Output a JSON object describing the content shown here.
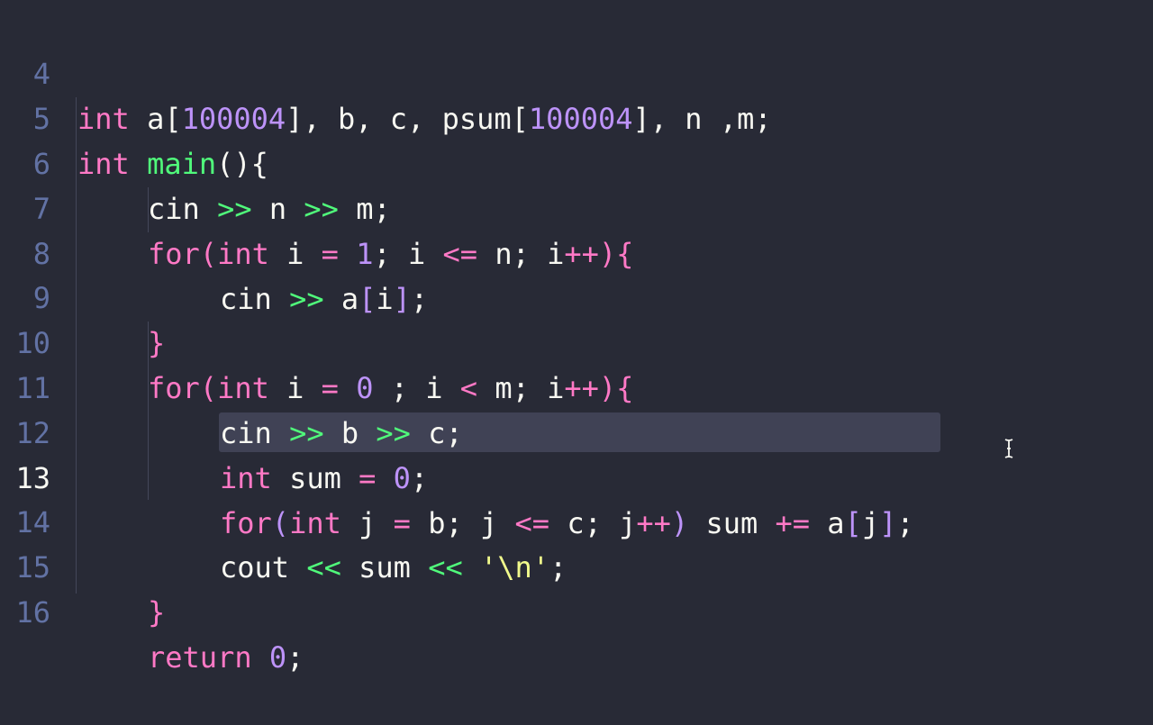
{
  "editor": {
    "lines": [
      {
        "num": "4"
      },
      {
        "num": "5"
      },
      {
        "num": "6"
      },
      {
        "num": "7"
      },
      {
        "num": "8"
      },
      {
        "num": "9"
      },
      {
        "num": "10"
      },
      {
        "num": "11"
      },
      {
        "num": "12"
      },
      {
        "num": "13"
      },
      {
        "num": "14"
      },
      {
        "num": "15"
      },
      {
        "num": "16"
      }
    ],
    "current_line": "13",
    "theme_colors": {
      "background": "#282a36",
      "keyword": "#ff79c6",
      "function": "#50fa7b",
      "number": "#bd93f9",
      "string": "#f1fa8c",
      "line_highlight": "#44475a"
    }
  },
  "code": {
    "l4": {
      "t1": "int",
      "t2": " a[",
      "n1": "100004",
      "t3": "], b, c, psum[",
      "n2": "100004",
      "t4": "], n ,m;"
    },
    "l5": {
      "t1": "int",
      "t2": " ",
      "fn": "main",
      "t3": "(){"
    },
    "l6": {
      "t1": "cin ",
      "op1": ">>",
      "t2": " n ",
      "op2": ">>",
      "t3": " m;"
    },
    "l7": {
      "kw": "for",
      "p1": "(",
      "ty": "int",
      "t1": " i ",
      "op1": "=",
      "t2": " ",
      "n1": "1",
      "t3": "; i ",
      "op2": "<=",
      "t4": " n; i",
      "op3": "++",
      "p2": ")",
      "p3": "{"
    },
    "l8": {
      "t1": "cin ",
      "op1": ">>",
      "t2": " a",
      "b1": "[",
      "t3": "i",
      "b2": "]",
      "t4": ";"
    },
    "l9": {
      "p1": "}"
    },
    "l10": {
      "kw": "for",
      "p1": "(",
      "ty": "int",
      "t1": " i ",
      "op1": "=",
      "t2": " ",
      "n1": "0",
      "t3": " ; i ",
      "op2": "<",
      "t4": " m; i",
      "op3": "++",
      "p2": ")",
      "p3": "{"
    },
    "l11": {
      "t1": "cin ",
      "op1": ">>",
      "t2": " b ",
      "op2": ">>",
      "t3": " c;"
    },
    "l12": {
      "ty": "int",
      "t1": " sum ",
      "op1": "=",
      "t2": " ",
      "n1": "0",
      "t3": ";"
    },
    "l13": {
      "kw": "for",
      "p1": "(",
      "ty": "int",
      "t1": " j ",
      "op1": "=",
      "t2": " b; j ",
      "op2": "<=",
      "t3": " c; j",
      "op3": "++",
      "p2": ")",
      "t4": " sum ",
      "op4": "+=",
      "t5": " a",
      "b1": "[",
      "t6": "j",
      "b2": "]",
      "t7": ";"
    },
    "l14": {
      "t1": "cout ",
      "op1": "<<",
      "t2": " sum ",
      "op2": "<<",
      "t3": " ",
      "s1": "'\\n'",
      "t4": ";"
    },
    "l15": {
      "p1": "}"
    },
    "l16": {
      "kw": "return",
      "t1": " ",
      "n1": "0",
      "t2": ";"
    }
  }
}
